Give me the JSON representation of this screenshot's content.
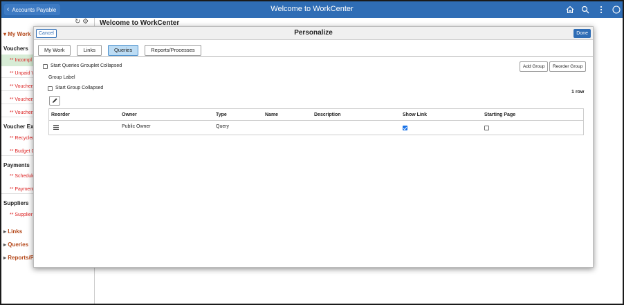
{
  "banner": {
    "back_label": "Accounts Payable",
    "title": "Welcome to WorkCenter",
    "icons": [
      "home-icon",
      "search-icon",
      "actions-menu-icon",
      "navbar-icon"
    ]
  },
  "page": {
    "title": "Welcome to WorkCenter"
  },
  "sidebar": {
    "my_work": "My Work",
    "groups": [
      {
        "label": "Vouchers",
        "items": [
          "** Incompl",
          "** Unpaid V",
          "** Vouchers",
          "** Vouchers",
          "** Vouchers"
        ]
      },
      {
        "label": "Voucher Exc",
        "items": [
          "** Recycled",
          "** Budget C"
        ]
      },
      {
        "label": "Payments",
        "items": [
          "** Schedule",
          "** Payment"
        ]
      },
      {
        "label": "Suppliers",
        "items": [
          "** Supplier"
        ]
      }
    ],
    "links": "Links",
    "queries": "Queries",
    "reports": "Reports/P"
  },
  "modal": {
    "cancel_label": "Cancel",
    "title": "Personalize",
    "done_label": "Done",
    "tabs": [
      {
        "label": "My Work",
        "active": false
      },
      {
        "label": "Links",
        "active": false
      },
      {
        "label": "Queries",
        "active": true
      },
      {
        "label": "Reports/Processes",
        "active": false
      }
    ],
    "grouplet_collapsed_label": "Start Queries Grouplet Collapsed",
    "add_group_label": "Add Group",
    "reorder_group_label": "Reorder Group",
    "group_label_heading": "Group Label",
    "group_collapsed_label": "Start Group Collapsed",
    "row_count": "1 row",
    "grid": {
      "columns": [
        "Reorder",
        "Owner",
        "Type",
        "Name",
        "Description",
        "Show Link",
        "Starting Page"
      ],
      "rows": [
        {
          "owner": "Public Owner",
          "type": "Query",
          "name": "",
          "description": "",
          "show_link": true,
          "starting_page": false
        }
      ]
    }
  },
  "colors": {
    "banner": "#2f6db5",
    "active_tab": "#bcdcf4",
    "sidebar_item": "#dd2222",
    "section_header": "#b54a1c"
  }
}
